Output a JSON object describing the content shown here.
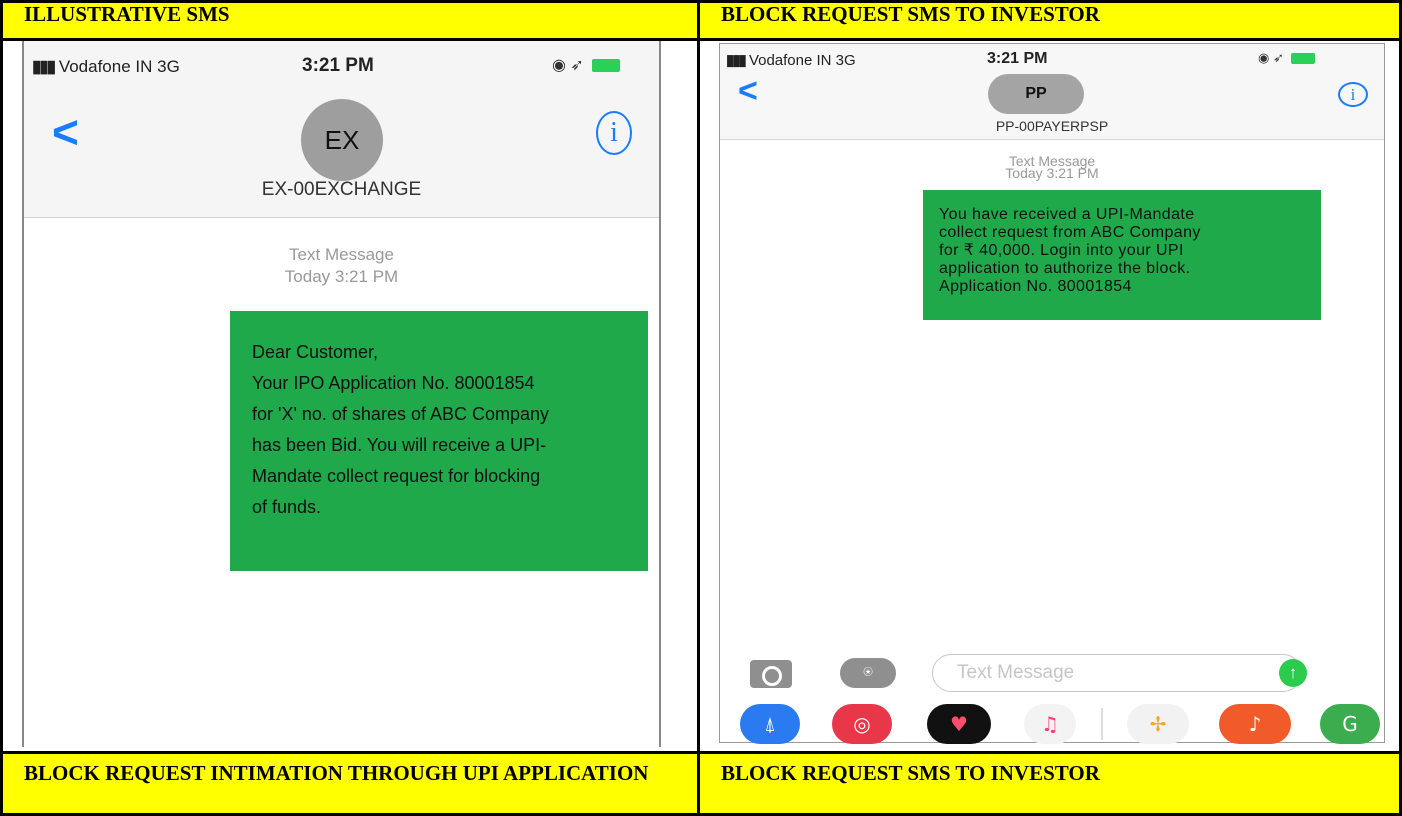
{
  "headers": {
    "top_left": "ILLUSTRATIVE SMS",
    "top_right": "BLOCK REQUEST SMS TO INVESTOR",
    "bottom_left": "BLOCK REQUEST INTIMATION THROUGH UPI APPLICATION",
    "bottom_right": "BLOCK REQUEST SMS TO INVESTOR"
  },
  "left_phone": {
    "carrier": "Vodafone IN 3G",
    "time": "3:21 PM",
    "avatar_initials": "EX",
    "sender": "EX-00EXCHANGE",
    "meta_line1": "Text Message",
    "meta_line2": "Today 3:21 PM",
    "message_lines": [
      "Dear Customer,",
      "Your IPO Application No. 80001854",
      "for 'X' no. of shares of ABC Company",
      "has been Bid. You will receive a UPI-",
      "Mandate collect request for blocking",
      "of funds."
    ]
  },
  "right_phone": {
    "carrier": "Vodafone IN 3G",
    "time": "3:21 PM",
    "avatar_initials": "PP",
    "sender": "PP-00PAYERPSP",
    "meta_line1": "Text Message",
    "meta_line2": "Today 3:21 PM",
    "message_lines": [
      "You have received a UPI-Mandate",
      "collect request from ABC Company",
      "for ₹ 40,000. Login into your UPI",
      "application to authorize the block.",
      "Application No. 80001854"
    ],
    "input_placeholder": "Text Message"
  },
  "icons": {
    "back": "chevron-left-icon",
    "info": "info-icon",
    "camera": "camera-icon",
    "apps": "app-store-icon",
    "send": "send-arrow-icon"
  },
  "colors": {
    "header_yellow": "#ffff00",
    "bubble_green": "#1fa94b",
    "ios_blue": "#1a7cff"
  }
}
